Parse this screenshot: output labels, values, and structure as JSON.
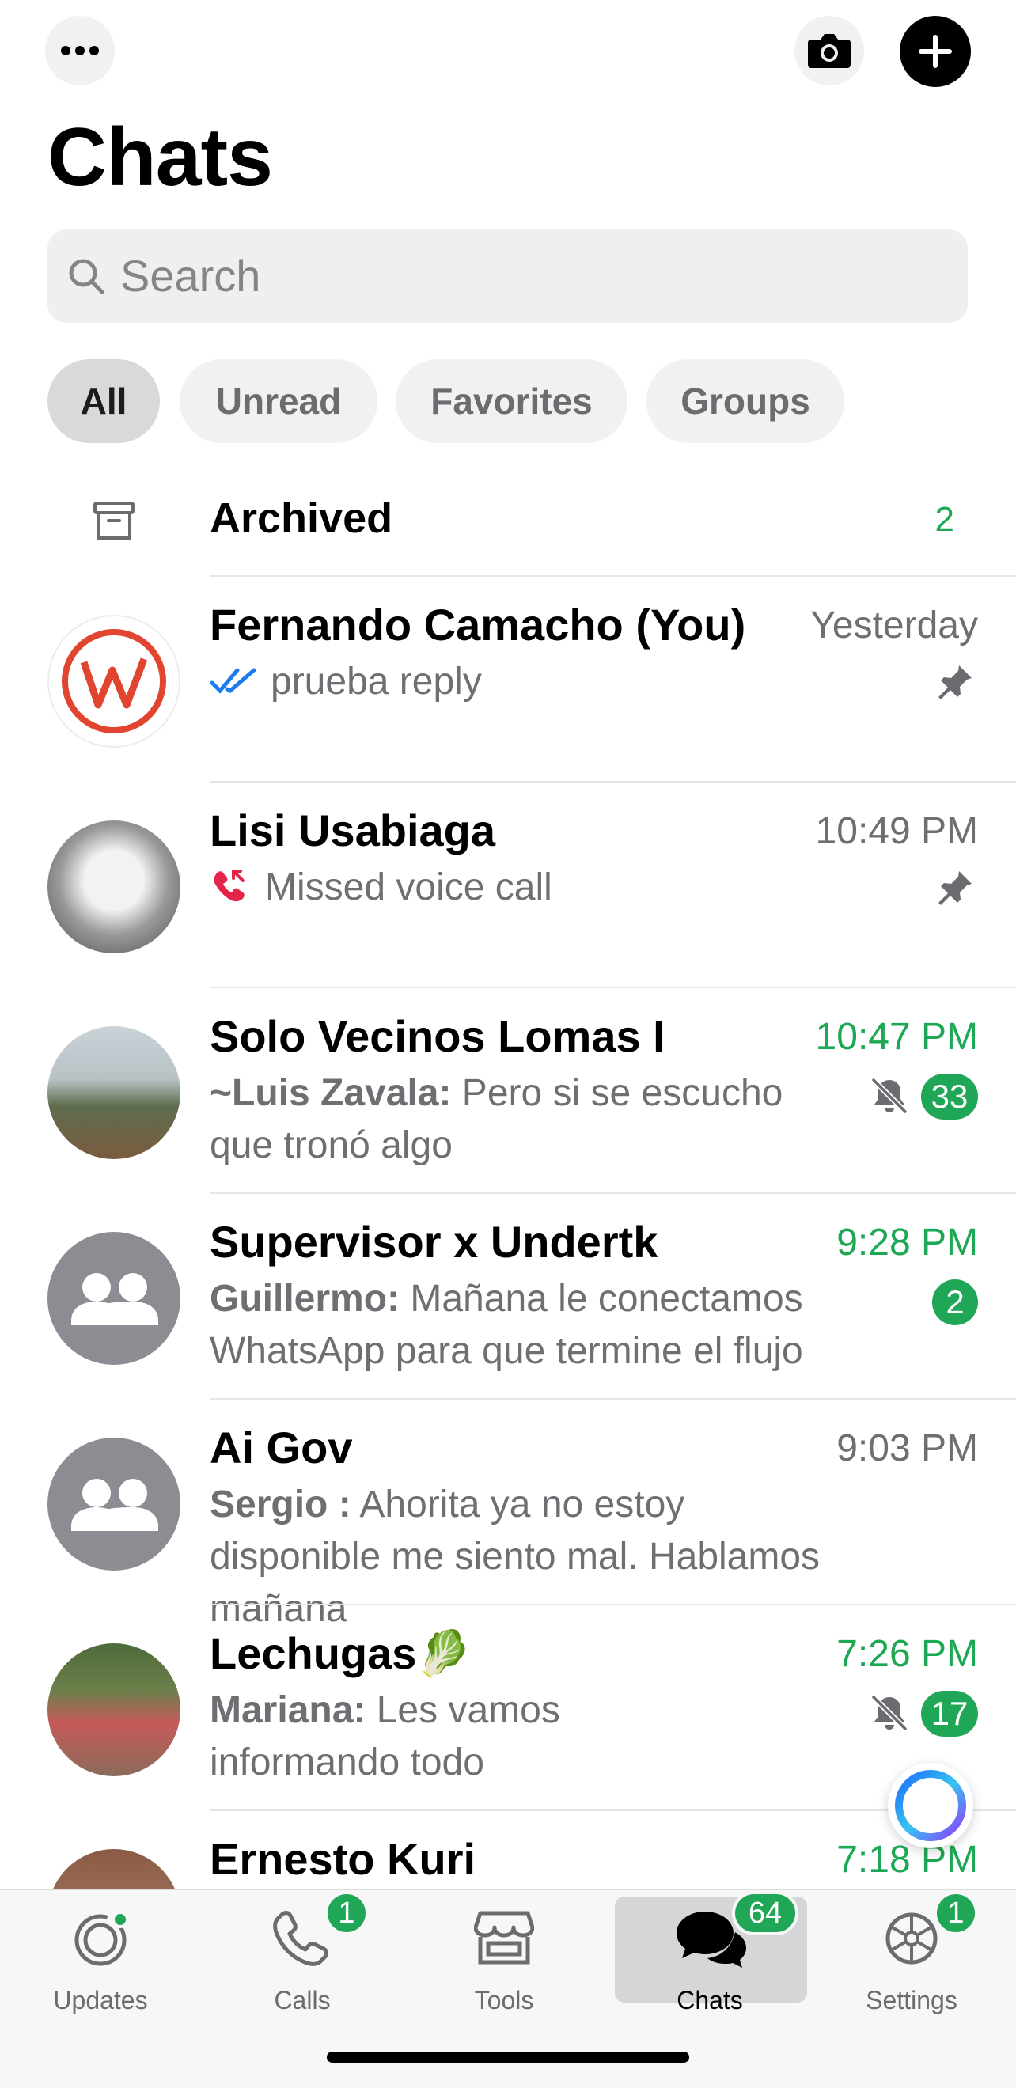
{
  "header": {
    "title": "Chats",
    "icons": {
      "more": "ellipsis-icon",
      "camera": "camera-icon",
      "new_chat": "plus-icon"
    }
  },
  "search": {
    "placeholder": "Search"
  },
  "filters": [
    {
      "label": "All",
      "active": true
    },
    {
      "label": "Unread",
      "active": false
    },
    {
      "label": "Favorites",
      "active": false
    },
    {
      "label": "Groups",
      "active": false
    }
  ],
  "archived": {
    "label": "Archived",
    "count": "2"
  },
  "chats": [
    {
      "name": "Fernando Camacho (You)",
      "time": "Yesterday",
      "time_green": false,
      "sender": "",
      "message": "prueba reply",
      "status_icon": "double-check-icon",
      "pinned": true,
      "muted": false,
      "unread": ""
    },
    {
      "name": "Lisi Usabiaga",
      "time": "10:49 PM",
      "time_green": false,
      "sender": "",
      "message": "Missed voice call",
      "status_icon": "missed-call-icon",
      "pinned": true,
      "muted": false,
      "unread": ""
    },
    {
      "name": "Solo Vecinos Lomas I",
      "time": "10:47 PM",
      "time_green": true,
      "sender": "~Luis Zavala:",
      "message": " Pero si  se escucho que tronó algo",
      "pinned": false,
      "muted": true,
      "unread": "33"
    },
    {
      "name": "Supervisor x Undertk",
      "time": "9:28 PM",
      "time_green": true,
      "sender": "Guillermo:",
      "message": " Mañana le conectamos WhatsApp para que termine el flujo",
      "pinned": false,
      "muted": false,
      "unread": "2"
    },
    {
      "name": "Ai Gov",
      "time": "9:03 PM",
      "time_green": false,
      "sender": "Sergio :",
      "message": " Ahorita ya no estoy disponible me siento mal. Hablamos mañana",
      "pinned": false,
      "muted": false,
      "unread": ""
    },
    {
      "name": "Lechugas🥬",
      "time": "7:26 PM",
      "time_green": true,
      "sender": "Mariana:",
      "message": " Les vamos informando todo",
      "pinned": false,
      "muted": true,
      "unread": "17"
    },
    {
      "name": "Ernesto Kuri",
      "time": "7:18 PM",
      "time_green": true,
      "sender": "",
      "message": "",
      "pinned": false,
      "muted": false,
      "unread": ""
    }
  ],
  "tabbar": [
    {
      "label": "Updates",
      "icon": "updates-icon",
      "badge": ""
    },
    {
      "label": "Calls",
      "icon": "phone-icon",
      "badge": "1"
    },
    {
      "label": "Tools",
      "icon": "storefront-icon",
      "badge": ""
    },
    {
      "label": "Chats",
      "icon": "chats-icon",
      "badge": "64",
      "active": true
    },
    {
      "label": "Settings",
      "icon": "gear-icon",
      "badge": "1"
    }
  ],
  "colors": {
    "accent_green": "#20a657",
    "blue_check": "#1a7cf0",
    "missed_red": "#e5244a"
  }
}
